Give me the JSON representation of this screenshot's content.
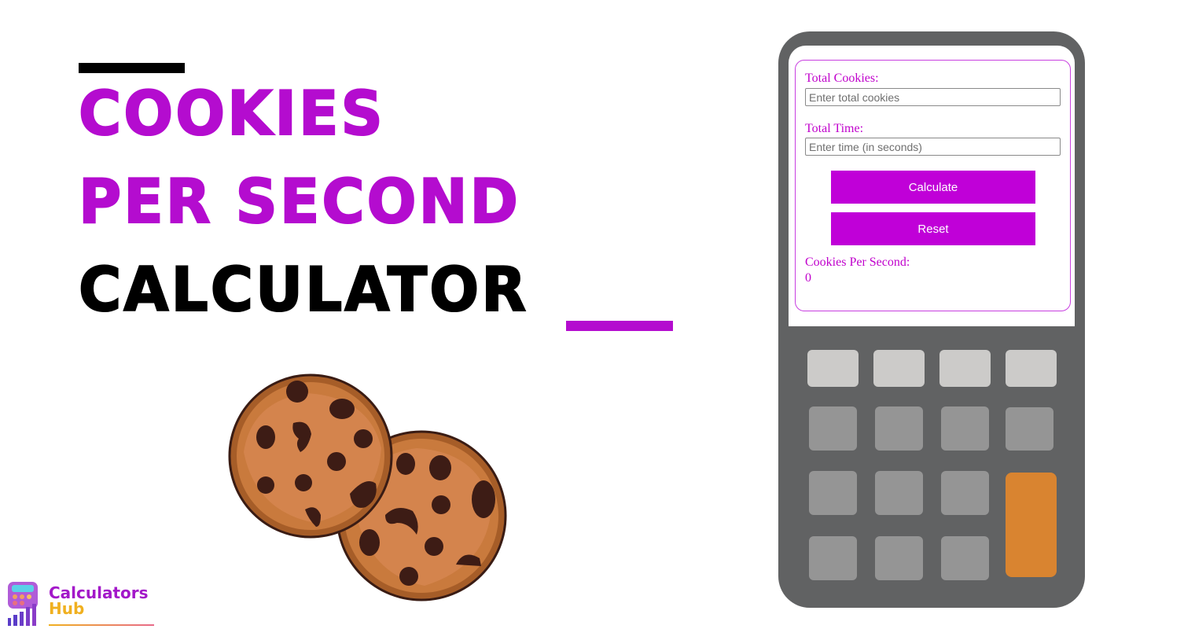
{
  "hero": {
    "title_line1": "Cookies",
    "title_line2": "Per Second",
    "title_line3": "Calculator",
    "accent_color": "#b40ccf"
  },
  "calculator": {
    "fields": [
      {
        "label": "Total Cookies:",
        "placeholder": "Enter total cookies",
        "value": ""
      },
      {
        "label": "Total Time:",
        "placeholder": "Enter time (in seconds)",
        "value": ""
      }
    ],
    "buttons": {
      "calculate": "Calculate",
      "reset": "Reset"
    },
    "result": {
      "label": "Cookies Per Second:",
      "value": "0"
    },
    "button_color": "#c000d8",
    "keypad_accent_color": "#d98430"
  },
  "illustration": {
    "icon": "cookies-icon"
  },
  "logo": {
    "line1": "Calculators",
    "line2": "Hub",
    "icon": "calculator-chart-icon"
  }
}
